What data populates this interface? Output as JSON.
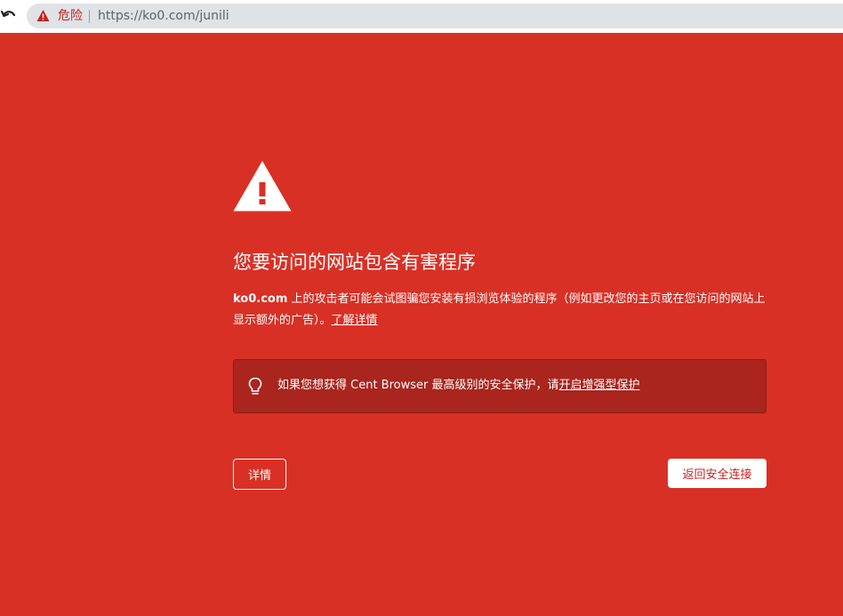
{
  "browser": {
    "security_label": "危险",
    "url": "https://ko0.com/junili",
    "icons": [
      "back-arrow-icon",
      "warning-icon"
    ]
  },
  "interstitial": {
    "title": "您要访问的网站包含有害程序",
    "description": {
      "domain": "ko0.com",
      "text": " 上的攻击者可能会试图骗您安装有损浏览体验的程序（例如更改您的主页或在您访问的网站上显示额外的广告）。",
      "learn_more": "了解详情"
    },
    "tip": {
      "icon": "lightbulb-icon",
      "text": "如果您想获得 Cent Browser 最高级别的安全保护，请",
      "link": "开启增强型保护"
    },
    "details_label": "详情",
    "back_to_safety_label": "返回安全连接"
  },
  "colors": {
    "background": "#d93025",
    "tip_background": "#a9251d",
    "danger_text": "#c5221f"
  }
}
